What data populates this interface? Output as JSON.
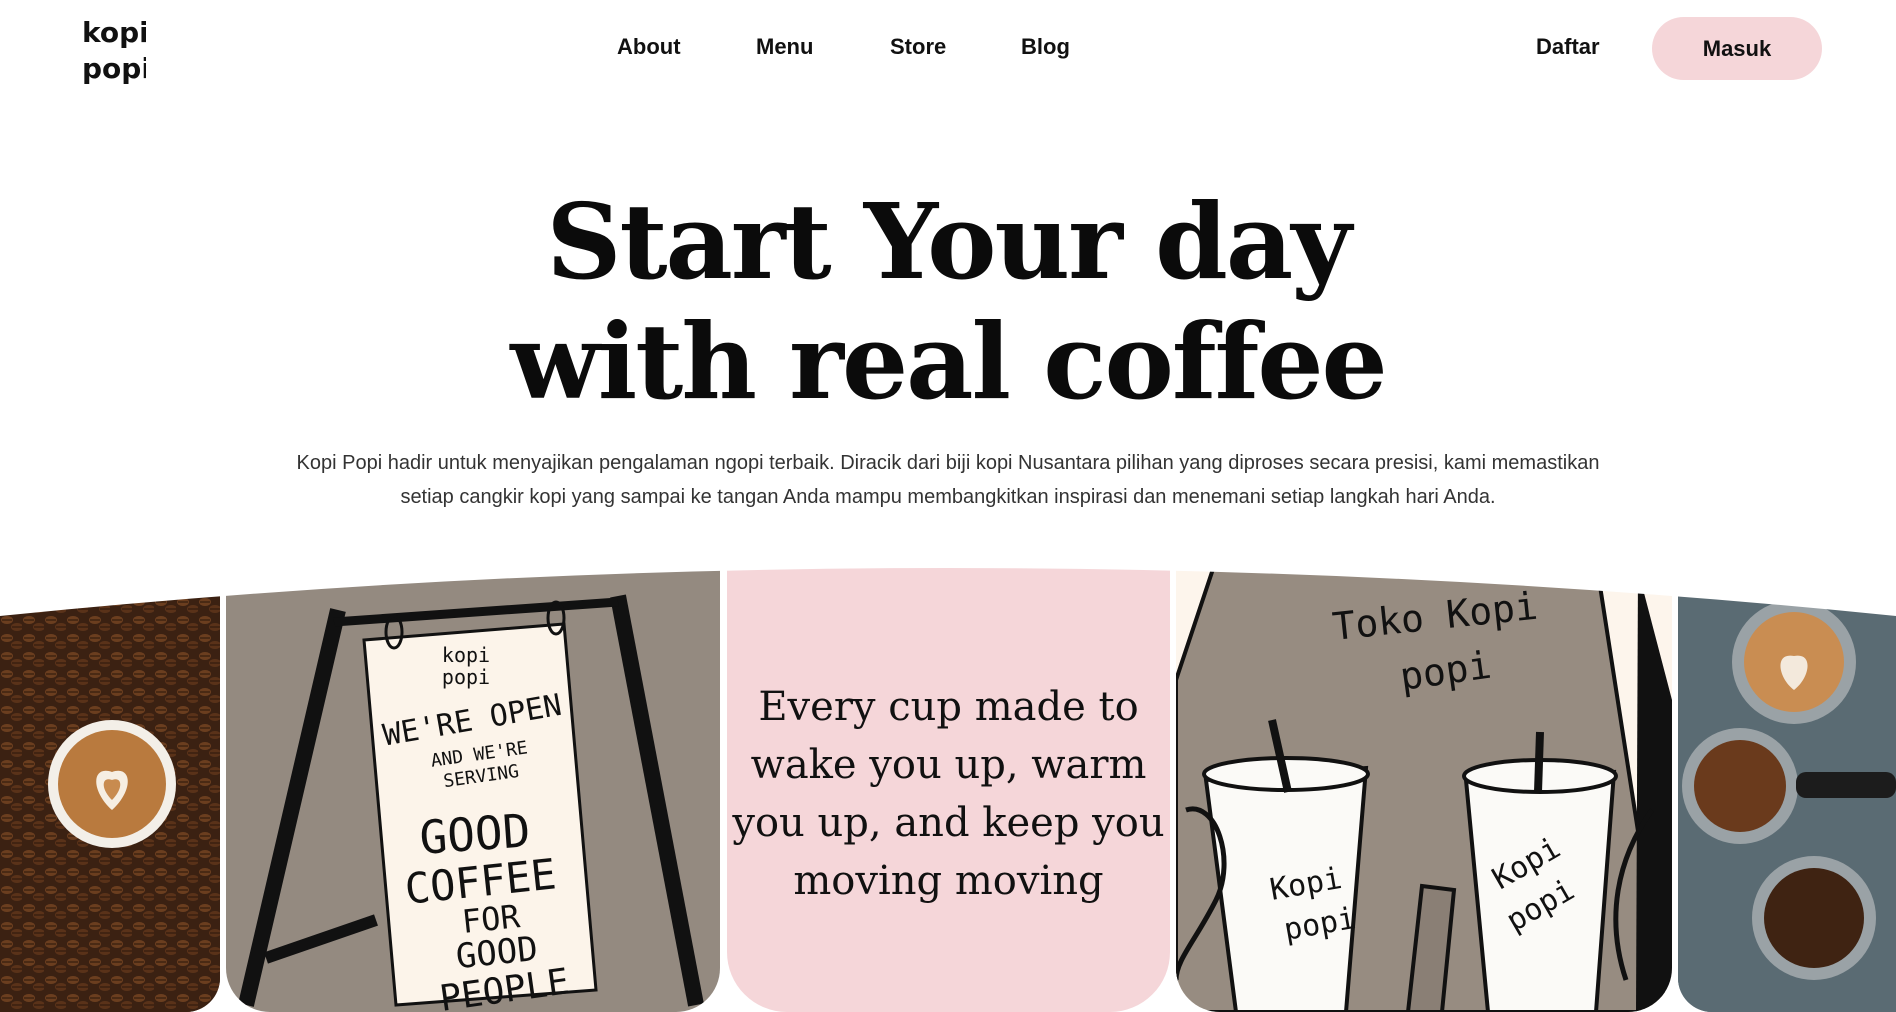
{
  "brand": {
    "logo_text_line1": "kopi",
    "logo_text_line2": "popi"
  },
  "nav": {
    "items": [
      "About",
      "Menu",
      "Store",
      "Blog"
    ]
  },
  "auth": {
    "register_label": "Daftar",
    "login_label": "Masuk"
  },
  "hero": {
    "title_line1": "Start Your day",
    "title_line2": "with real coffee",
    "description": "Kopi Popi hadir untuk menyajikan pengalaman ngopi terbaik. Diracik dari biji kopi Nusantara pilihan yang diproses secara presisi, kami memastikan setiap cangkir kopi yang sampai ke tangan Anda mampu membangkitkan inspirasi dan menemani setiap langkah hari Anda."
  },
  "gallery": {
    "quote": "Every cup made to wake you up, warm you up, and keep you moving moving",
    "sign_text": [
      "kopi",
      "popi",
      "WE'RE OPEN",
      "AND WE'RE",
      "SERVING",
      "GOOD",
      "COFFEE",
      "FOR",
      "GOOD",
      "PEOPLE"
    ],
    "shop_text": [
      "Toko Kopi",
      "popi"
    ],
    "cup_text": [
      "Kopi",
      "popi"
    ]
  },
  "colors": {
    "accent_pink": "#f5d6d9",
    "sketch_grey": "#948a80",
    "cream": "#fdf5ec"
  }
}
